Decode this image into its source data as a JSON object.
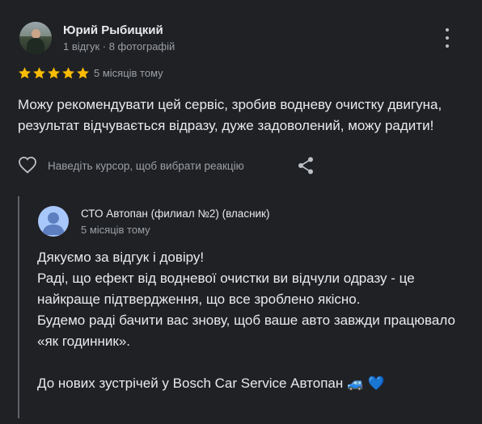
{
  "review": {
    "author_name": "Юрий Рыбицкий",
    "author_meta": "1 відгук · 8 фотографій",
    "rating": 5,
    "time": "5 місяців тому",
    "text": "Можу рекомендувати цей сервіс, зробив водневу очистку двигуна,\nрезультат відчувається відразу, дуже задоволений, можу радити!",
    "reaction_hint": "Наведіть курсор, щоб вибрати реакцію"
  },
  "owner_response": {
    "name": "СТО Автопан (филиал №2) (власник)",
    "time": "5 місяців тому",
    "text": "Дякуємо за відгук і довіру!\nРаді, що ефект від водневої очистки ви відчули одразу - це найкраще підтвердження, що все зроблено якісно.\nБудемо раді бачити вас знову, щоб ваше авто завжди працювало «як годинник».\n\nДо нових зустрічей у Bosch Car Service Автопан 🚙 💙"
  },
  "icons": {
    "star": "star-icon",
    "heart": "heart-outline-icon",
    "share": "share-icon",
    "more": "more-vert-icon",
    "owner_avatar": "default-person-avatar"
  },
  "colors": {
    "background": "#202124",
    "star": "#fbbc04",
    "primary_text": "#e8eaed",
    "secondary_text": "#9aa0a6",
    "owner_avatar_bg": "#a8c7fa"
  }
}
